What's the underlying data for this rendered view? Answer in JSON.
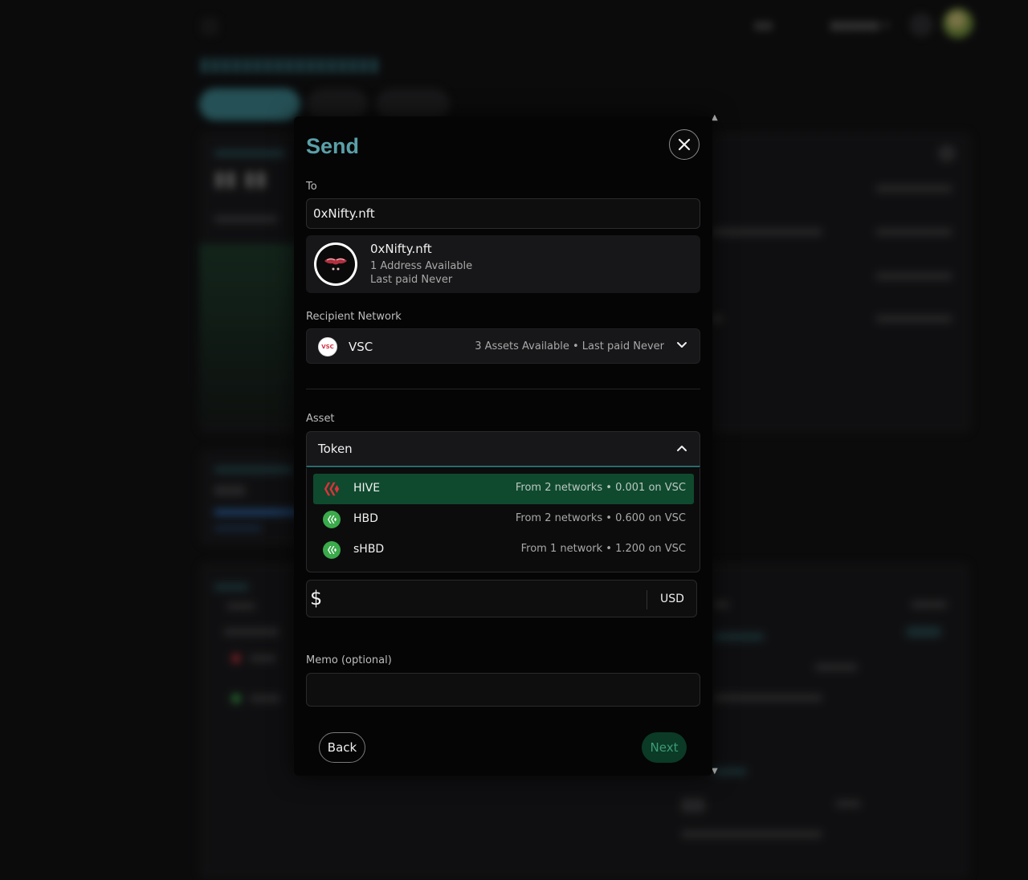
{
  "modal": {
    "title": "Send",
    "to_label": "To",
    "to_value": "0xNifty.nft",
    "contact": {
      "name": "0xNifty.nft",
      "addresses": "1 Address Available",
      "last_paid": "Last paid Never"
    },
    "network_label": "Recipient Network",
    "network": {
      "name": "VSC",
      "logo_text": "VSC",
      "meta": "3 Assets Available  •  Last paid Never"
    },
    "asset_label": "Asset",
    "asset_value": "Token",
    "assets": [
      {
        "name": "HIVE",
        "meta": "From 2 networks  •  0.001 on VSC",
        "icon": "hive-icon",
        "selected": true
      },
      {
        "name": "HBD",
        "meta": "From 2 networks  •  0.600 on VSC",
        "icon": "hbd-icon",
        "selected": false
      },
      {
        "name": "sHBD",
        "meta": "From 1 network  •  1.200 on VSC",
        "icon": "shbd-icon",
        "selected": false
      }
    ],
    "amount": {
      "symbol": "$",
      "value": "",
      "unit": "USD"
    },
    "memo_label": "Memo (optional)",
    "memo_value": "",
    "back_label": "Back",
    "next_label": "Next"
  },
  "colors": {
    "title": "#5aa0a8",
    "selected_row": "#0f4a2e",
    "next_button": "#0b3a26",
    "hive_red": "#e0313b",
    "hbd_green": "#3aaa4a"
  }
}
